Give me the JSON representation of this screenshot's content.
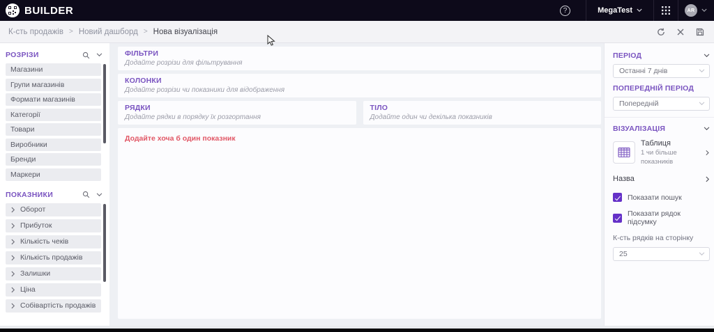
{
  "navbar": {
    "brand": "BUILDER",
    "workspace": "MegaTest",
    "avatar_initials": "AR",
    "help_glyph": "?"
  },
  "breadcrumb": {
    "items": [
      "К-сть продажів",
      "Новий дашборд",
      "Нова візуалізація"
    ],
    "separator": ">"
  },
  "sidebar_left": {
    "dimensions": {
      "title": "РОЗРІЗИ",
      "items": [
        "Магазини",
        "Групи магазинів",
        "Формати магазинів",
        "Категорії",
        "Товари",
        "Виробники",
        "Бренди",
        "Маркери"
      ]
    },
    "measures": {
      "title": "ПОКАЗНИКИ",
      "items": [
        "Оборот",
        "Прибуток",
        "Кількість чеків",
        "Кількість продажів",
        "Залишки",
        "Ціна",
        "Собівартість продажів"
      ]
    }
  },
  "builder": {
    "filters": {
      "title": "ФІЛЬТРИ",
      "hint": "Додайте розрізи для фільтрування"
    },
    "columns": {
      "title": "КОЛОНКИ",
      "hint": "Додайте розрізи чи показники для відображення"
    },
    "rows": {
      "title": "РЯДКИ",
      "hint": "Додайте рядки в порядку їх розгортання"
    },
    "body": {
      "title": "ТІЛО",
      "hint": "Додайте один чи декілька показників"
    },
    "validation_message": "Додайте хоча б один показник"
  },
  "settings": {
    "period_label": "ПЕРІОД",
    "period_value": "Останні 7 днів",
    "prev_period_label": "ПОПЕРЕДНІЙ ПЕРІОД",
    "prev_period_value": "Попередній",
    "visualization_label": "ВІЗУАЛІЗАЦІЯ",
    "viz_type": "Таблиця",
    "viz_desc": "1 чи більше показників",
    "name_label": "Назва",
    "show_search": {
      "label": "Показати пошук",
      "checked": true
    },
    "show_total_row": {
      "label": "Показати рядок підсумку",
      "checked": true
    },
    "rows_per_page_label": "К-сть рядків на сторінку",
    "rows_per_page_value": "25"
  },
  "colors": {
    "accent_purple": "#7a54c0",
    "checkbox_purple": "#6531c8",
    "error_red": "#e15766",
    "navbar_bg": "#0d0a1a"
  }
}
